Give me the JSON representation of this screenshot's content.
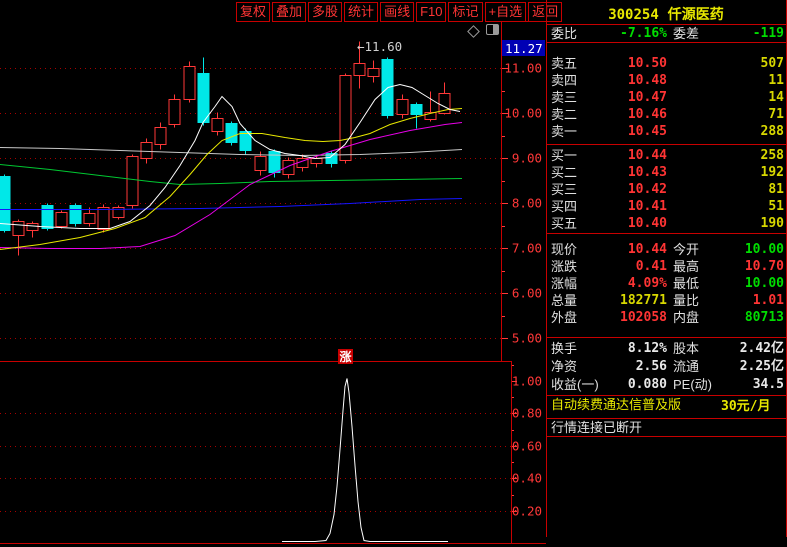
{
  "menu": {
    "items": [
      "复权",
      "叠加",
      "多股",
      "统计",
      "画线",
      "F10",
      "标记",
      "+自选",
      "返回"
    ]
  },
  "icons": [
    "diamond-marker-icon",
    "window-panel-icon"
  ],
  "titlebar": {
    "code": "300254",
    "name": "仟源医药"
  },
  "quote": {
    "weibi": {
      "l1": "委比",
      "v1": "-7.16%",
      "c1": "green",
      "l2": "委差",
      "v2": "-119",
      "c2": "green"
    },
    "sells": [
      {
        "label": "卖五",
        "price": "10.50",
        "vol": "507"
      },
      {
        "label": "卖四",
        "price": "10.48",
        "vol": "11"
      },
      {
        "label": "卖三",
        "price": "10.47",
        "vol": "14"
      },
      {
        "label": "卖二",
        "price": "10.46",
        "vol": "71"
      },
      {
        "label": "卖一",
        "price": "10.45",
        "vol": "288"
      }
    ],
    "buys": [
      {
        "label": "买一",
        "price": "10.44",
        "vol": "258"
      },
      {
        "label": "买二",
        "price": "10.43",
        "vol": "192"
      },
      {
        "label": "买三",
        "price": "10.42",
        "vol": "81"
      },
      {
        "label": "买四",
        "price": "10.41",
        "vol": "51"
      },
      {
        "label": "买五",
        "price": "10.40",
        "vol": "190"
      }
    ],
    "stats": [
      {
        "l1": "现价",
        "v1": "10.44",
        "c1": "red",
        "l2": "今开",
        "v2": "10.00",
        "c2": "green"
      },
      {
        "l1": "涨跌",
        "v1": "0.41",
        "c1": "red",
        "l2": "最高",
        "v2": "10.70",
        "c2": "red"
      },
      {
        "l1": "涨幅",
        "v1": "4.09%",
        "c1": "red",
        "l2": "最低",
        "v2": "10.00",
        "c2": "green"
      },
      {
        "l1": "总量",
        "v1": "182771",
        "c1": "yellow",
        "l2": "量比",
        "v2": "1.01",
        "c2": "red"
      },
      {
        "l1": "外盘",
        "v1": "102058",
        "c1": "red",
        "l2": "内盘",
        "v2": "80713",
        "c2": "green"
      }
    ],
    "stats2": [
      {
        "l1": "换手",
        "v1": "8.12%",
        "c1": "white",
        "l2": "股本",
        "v2": "2.42亿",
        "c2": "white"
      },
      {
        "l1": "净资",
        "v1": "2.56",
        "c1": "white",
        "l2": "流通",
        "v2": "2.25亿",
        "c2": "white"
      },
      {
        "l1": "收益(一)",
        "v1": "0.080",
        "c1": "white",
        "l2": "PE(动)",
        "v2": "34.5",
        "c2": "white"
      }
    ],
    "banner": {
      "text": "自动续费通达信普及版",
      "price": "30元/月"
    },
    "status": "行情连接已断开"
  },
  "chart_data": {
    "type": "candlestick",
    "price_axis_labels": [
      "11.00",
      "10.00",
      "9.00",
      "8.00",
      "7.00",
      "6.00",
      "5.00"
    ],
    "axis_marker": "11.27",
    "sub_axis_labels": [
      "1.00",
      "0.80",
      "0.60",
      "0.40",
      "0.20"
    ],
    "annotation": "←11.60",
    "badge": "涨",
    "ylim": [
      4.5,
      11.8
    ],
    "sub_ylim": [
      0,
      1.12
    ],
    "candles": [
      {
        "o": 8.6,
        "c": 7.4,
        "h": 8.65,
        "l": 7.35
      },
      {
        "o": 7.3,
        "c": 7.6,
        "h": 7.65,
        "l": 6.85
      },
      {
        "o": 7.4,
        "c": 7.55,
        "h": 7.6,
        "l": 7.25
      },
      {
        "o": 7.95,
        "c": 7.45,
        "h": 8.0,
        "l": 7.4
      },
      {
        "o": 7.5,
        "c": 7.8,
        "h": 7.85,
        "l": 7.45
      },
      {
        "o": 7.95,
        "c": 7.55,
        "h": 8.0,
        "l": 7.5
      },
      {
        "o": 7.55,
        "c": 7.78,
        "h": 7.92,
        "l": 7.5
      },
      {
        "o": 7.42,
        "c": 7.92,
        "h": 7.97,
        "l": 7.36
      },
      {
        "o": 7.7,
        "c": 7.91,
        "h": 7.96,
        "l": 7.65
      },
      {
        "o": 7.95,
        "c": 9.05,
        "h": 9.1,
        "l": 7.9
      },
      {
        "o": 9.0,
        "c": 9.35,
        "h": 9.45,
        "l": 8.9
      },
      {
        "o": 9.3,
        "c": 9.7,
        "h": 9.8,
        "l": 9.2
      },
      {
        "o": 9.75,
        "c": 10.3,
        "h": 10.42,
        "l": 9.7
      },
      {
        "o": 10.3,
        "c": 11.05,
        "h": 11.15,
        "l": 10.25
      },
      {
        "o": 10.9,
        "c": 9.8,
        "h": 11.25,
        "l": 9.73
      },
      {
        "o": 9.6,
        "c": 9.88,
        "h": 10.02,
        "l": 9.52
      },
      {
        "o": 9.77,
        "c": 9.35,
        "h": 9.82,
        "l": 9.28
      },
      {
        "o": 9.6,
        "c": 9.18,
        "h": 9.66,
        "l": 9.1
      },
      {
        "o": 8.73,
        "c": 9.05,
        "h": 9.15,
        "l": 8.62
      },
      {
        "o": 9.15,
        "c": 8.68,
        "h": 9.2,
        "l": 8.58
      },
      {
        "o": 8.64,
        "c": 8.95,
        "h": 9.03,
        "l": 8.55
      },
      {
        "o": 8.8,
        "c": 9.0,
        "h": 9.08,
        "l": 8.72
      },
      {
        "o": 8.88,
        "c": 9.0,
        "h": 9.06,
        "l": 8.8
      },
      {
        "o": 9.12,
        "c": 8.88,
        "h": 9.16,
        "l": 8.8
      },
      {
        "o": 8.95,
        "c": 10.85,
        "h": 10.9,
        "l": 8.9
      },
      {
        "o": 10.85,
        "c": 11.12,
        "h": 11.6,
        "l": 10.55
      },
      {
        "o": 10.82,
        "c": 11.0,
        "h": 11.18,
        "l": 10.7
      },
      {
        "o": 11.2,
        "c": 9.95,
        "h": 11.24,
        "l": 9.88
      },
      {
        "o": 9.97,
        "c": 10.32,
        "h": 10.42,
        "l": 9.9
      },
      {
        "o": 10.2,
        "c": 9.98,
        "h": 10.24,
        "l": 9.66
      },
      {
        "o": 9.87,
        "c": 10.02,
        "h": 10.49,
        "l": 9.82
      },
      {
        "o": 10.0,
        "c": 10.44,
        "h": 10.7,
        "l": 9.98
      }
    ],
    "ma_series": [
      {
        "name": "ma-long-gray",
        "color": "#c8c8c8",
        "points": [
          [
            0,
            9.24
          ],
          [
            60,
            9.22
          ],
          [
            120,
            9.18
          ],
          [
            180,
            9.13
          ],
          [
            240,
            9.09
          ],
          [
            300,
            9.07
          ],
          [
            360,
            9.1
          ],
          [
            410,
            9.14
          ],
          [
            462,
            9.19
          ]
        ]
      },
      {
        "name": "ma-green",
        "color": "#00c832",
        "points": [
          [
            0,
            8.87
          ],
          [
            50,
            8.76
          ],
          [
            100,
            8.62
          ],
          [
            150,
            8.48
          ],
          [
            180,
            8.43
          ],
          [
            220,
            8.44
          ],
          [
            270,
            8.49
          ],
          [
            330,
            8.52
          ],
          [
            400,
            8.54
          ],
          [
            462,
            8.55
          ]
        ]
      },
      {
        "name": "ma-blue",
        "color": "#1414ff",
        "points": [
          [
            0,
            7.87
          ],
          [
            100,
            7.86
          ],
          [
            200,
            7.88
          ],
          [
            280,
            7.93
          ],
          [
            350,
            8.0
          ],
          [
            420,
            8.08
          ],
          [
            462,
            8.12
          ]
        ]
      },
      {
        "name": "ma-magenta",
        "color": "#e800e8",
        "points": [
          [
            0,
            7.02
          ],
          [
            50,
            6.99
          ],
          [
            100,
            6.99
          ],
          [
            140,
            7.05
          ],
          [
            175,
            7.28
          ],
          [
            210,
            7.75
          ],
          [
            250,
            8.42
          ],
          [
            290,
            8.85
          ],
          [
            330,
            9.15
          ],
          [
            370,
            9.42
          ],
          [
            410,
            9.62
          ],
          [
            445,
            9.76
          ],
          [
            462,
            9.8
          ]
        ]
      },
      {
        "name": "ma-yellow",
        "color": "#e8e800",
        "points": [
          [
            0,
            6.98
          ],
          [
            40,
            7.1
          ],
          [
            80,
            7.25
          ],
          [
            115,
            7.45
          ],
          [
            145,
            7.7
          ],
          [
            170,
            8.16
          ],
          [
            190,
            8.65
          ],
          [
            207,
            9.1
          ],
          [
            222,
            9.4
          ],
          [
            240,
            9.56
          ],
          [
            262,
            9.55
          ],
          [
            285,
            9.47
          ],
          [
            305,
            9.41
          ],
          [
            323,
            9.38
          ],
          [
            340,
            9.4
          ],
          [
            355,
            9.46
          ],
          [
            370,
            9.55
          ],
          [
            390,
            9.75
          ],
          [
            410,
            9.9
          ],
          [
            430,
            10.0
          ],
          [
            448,
            10.08
          ],
          [
            462,
            10.12
          ]
        ]
      },
      {
        "name": "ma-white",
        "color": "#ffffff",
        "points": [
          [
            0,
            7.55
          ],
          [
            40,
            7.5
          ],
          [
            80,
            7.45
          ],
          [
            110,
            7.45
          ],
          [
            130,
            7.6
          ],
          [
            150,
            7.95
          ],
          [
            165,
            8.35
          ],
          [
            180,
            8.85
          ],
          [
            195,
            9.4
          ],
          [
            203,
            9.8
          ],
          [
            215,
            10.15
          ],
          [
            222,
            10.38
          ],
          [
            232,
            10.15
          ],
          [
            240,
            9.78
          ],
          [
            255,
            9.4
          ],
          [
            270,
            9.2
          ],
          [
            285,
            9.12
          ],
          [
            300,
            9.06
          ],
          [
            315,
            9.01
          ],
          [
            330,
            9.03
          ],
          [
            345,
            9.3
          ],
          [
            360,
            9.8
          ],
          [
            375,
            10.3
          ],
          [
            388,
            10.58
          ],
          [
            400,
            10.65
          ],
          [
            412,
            10.57
          ],
          [
            425,
            10.4
          ],
          [
            438,
            10.22
          ],
          [
            450,
            10.1
          ],
          [
            460,
            10.05
          ]
        ]
      }
    ],
    "sub_indicator": {
      "name": "signal-line",
      "color": "#ffffff",
      "points": [
        [
          282,
          0.01
        ],
        [
          300,
          0.01
        ],
        [
          315,
          0.01
        ],
        [
          326,
          0.02
        ],
        [
          330,
          0.06
        ],
        [
          334,
          0.18
        ],
        [
          337,
          0.35
        ],
        [
          340,
          0.58
        ],
        [
          343,
          0.82
        ],
        [
          345,
          0.97
        ],
        [
          347,
          1.02
        ],
        [
          349,
          0.93
        ],
        [
          352,
          0.72
        ],
        [
          355,
          0.48
        ],
        [
          358,
          0.26
        ],
        [
          361,
          0.1
        ],
        [
          364,
          0.02
        ],
        [
          370,
          0.01
        ],
        [
          400,
          0.01
        ],
        [
          430,
          0.01
        ],
        [
          448,
          0.01
        ]
      ]
    }
  }
}
